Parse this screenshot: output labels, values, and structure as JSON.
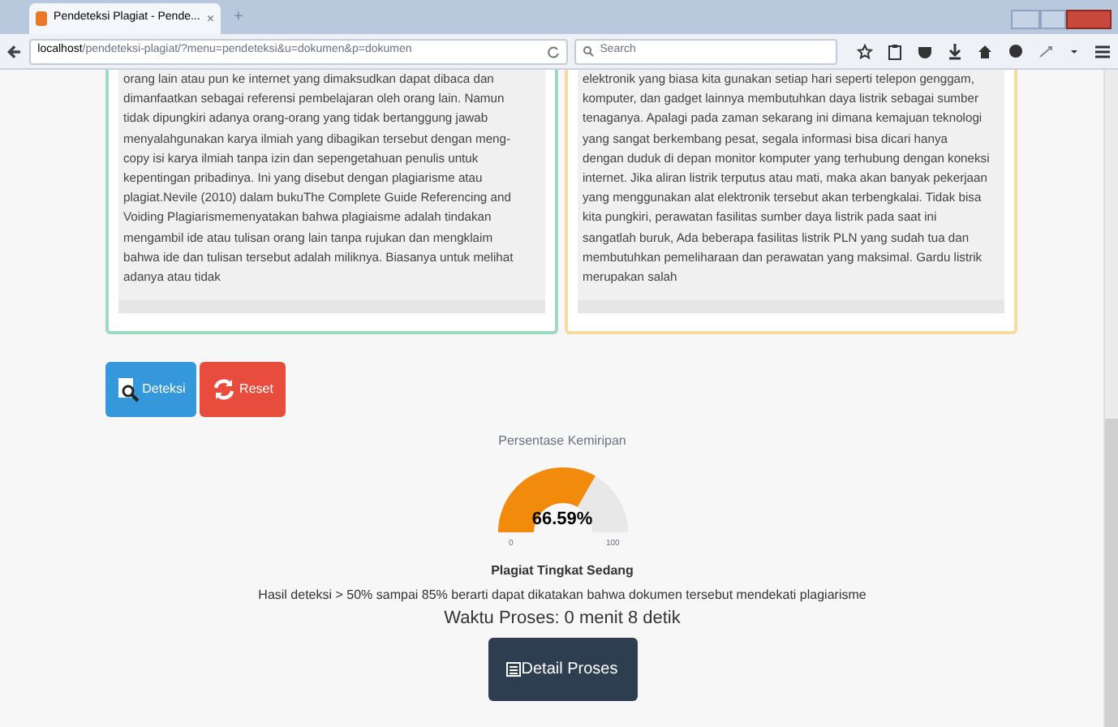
{
  "browser": {
    "tab_title": "Pendeteksi Plagiat - Pende...",
    "tab_close": "×",
    "new_tab": "+",
    "url_host": "localhost",
    "url_path": "/pendeteksi-plagiat/?menu=pendeteksi&u=dokumen&p=dokumen",
    "search_placeholder": "Search"
  },
  "documents": [
    {
      "text": "orang lain atau pun ke internet yang dimaksudkan dapat dibaca dan dimanfaatkan sebagai referensi pembelajaran oleh orang lain. Namun tidak dipungkiri adanya orang-orang yang tidak bertanggung jawab menyalahgunakan karya ilmiah yang dibagikan tersebut dengan meng-copy isi karya ilmiah tanpa izin dan sepengetahuan penulis untuk kepentingan pribadinya. Ini yang disebut dengan plagiarisme atau plagiat.Nevile (2010) dalam bukuThe Complete Guide Referencing and Voiding Plagiarismemenyatakan bahwa plagiaisme adalah tindakan mengambil ide atau tulisan orang lain tanpa rujukan dan mengklaim bahwa ide dan tulisan tersebut adalah miliknya. Biasanya untuk melihat adanya atau tidak"
    },
    {
      "text": "elektronik yang biasa kita gunakan setiap hari seperti telepon genggam, komputer, dan gadget lainnya membutuhkan daya listrik sebagai sumber tenaganya. Apalagi pada zaman sekarang ini dimana kemajuan teknologi yang sangat berkembang pesat, segala informasi bisa dicari hanya dengan duduk di depan monitor komputer yang terhubung dengan koneksi internet. Jika aliran listrik terputus atau mati, maka akan banyak pekerjaan yang menggunakan alat elektronik tersebut akan terbengkalai. Tidak bisa kita pungkiri, perawatan fasilitas sumber daya listrik pada saat ini sangatlah buruk, Ada beberapa fasilitas listrik PLN yang sudah tua dan membutuhkan pemeliharaan dan perawatan yang maksimal. Gardu listrik merupakan salah"
    }
  ],
  "buttons": [
    {
      "kind": "detect",
      "label": "Deteksi"
    },
    {
      "kind": "reset",
      "label": "Reset"
    }
  ],
  "result": {
    "title": "Persentase Kemiripan",
    "gauge": {
      "value": "66.59%",
      "min": "0",
      "max": "100"
    },
    "category": "Plagiat Tingkat Sedang",
    "description": "Hasil deteksi > 50% sampai 85% berarti dapat dikatakan bahwa dokumen tersebut mendekati plagiarisme",
    "time": "Waktu Proses: 0 menit 8 detik",
    "detail_button": "Detail Proses"
  }
}
